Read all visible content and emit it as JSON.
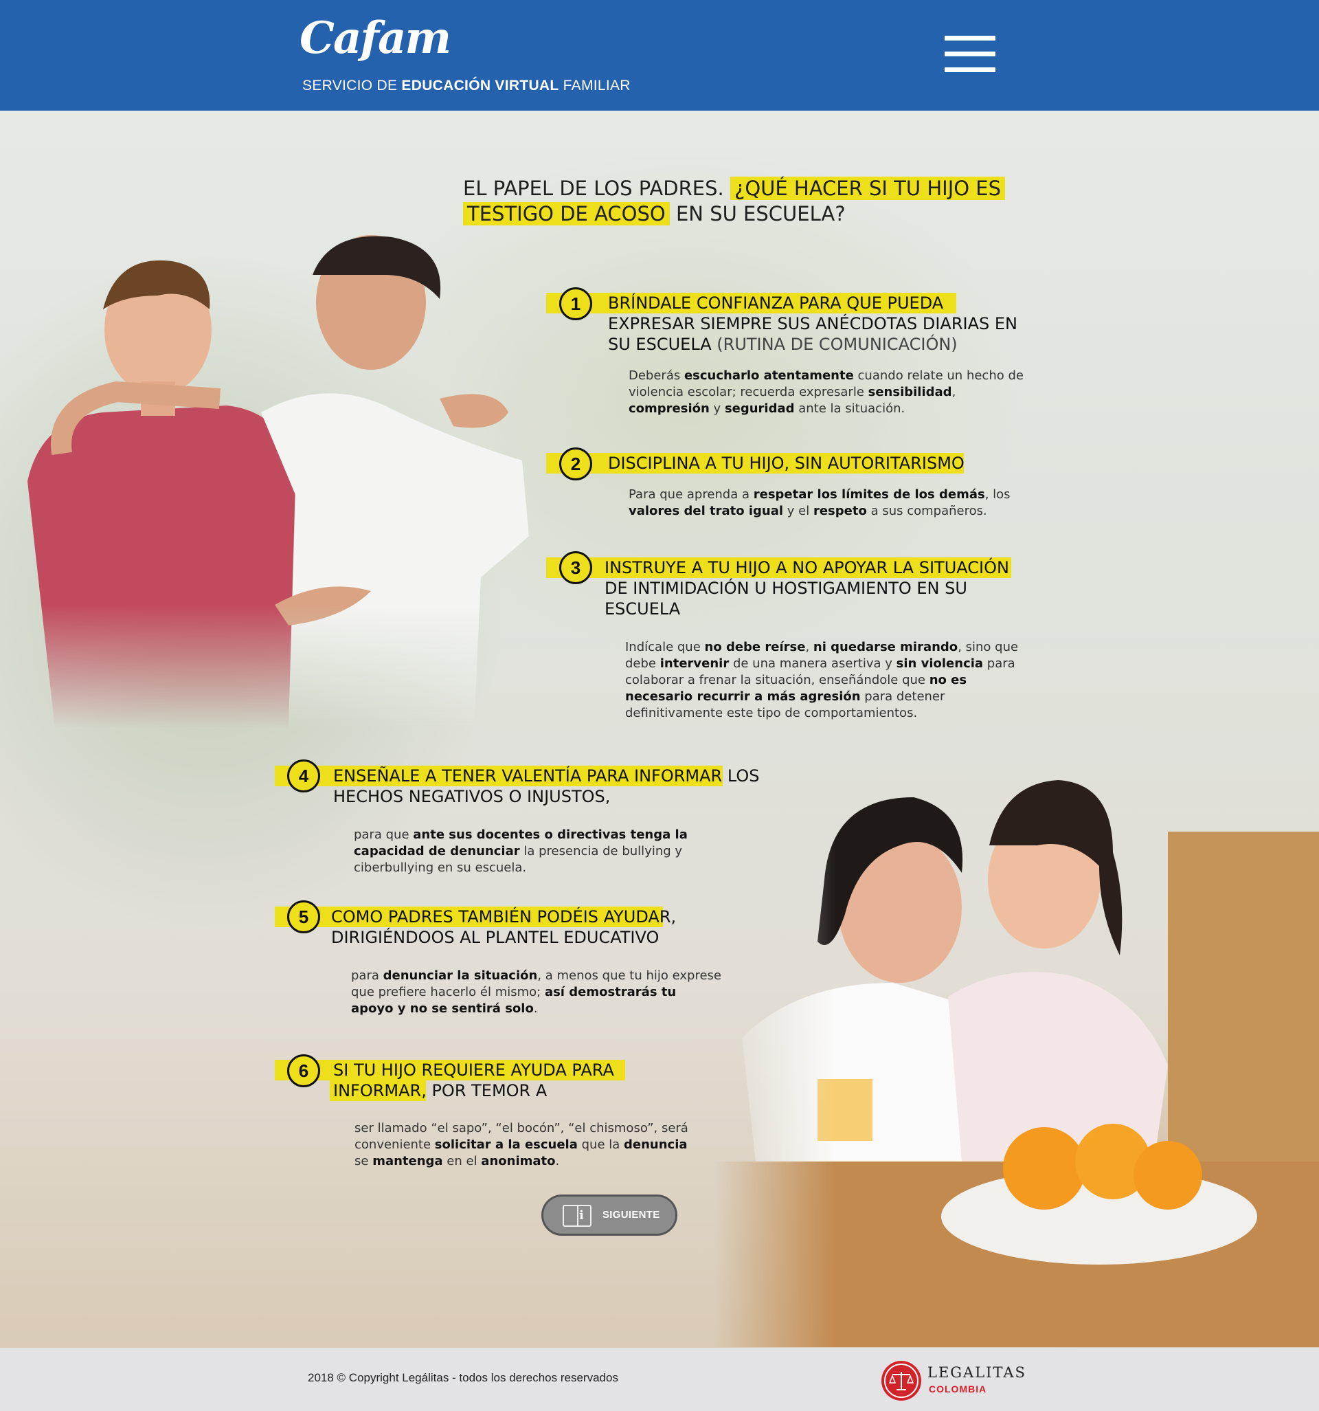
{
  "header": {
    "logo": "Cafam",
    "subtitle_pre": "SERVICIO DE ",
    "subtitle_bold": "EDUCACIÓN VIRTUAL",
    "subtitle_post": " FAMILIAR",
    "menu_icon": "hamburger-menu-icon"
  },
  "title": {
    "part1": "EL PAPEL DE LOS PADRES. ",
    "highlight1": "¿QUÉ HACER SI TU HIJO ES",
    "highlight2": "TESTIGO DE ACOSO",
    "part2": " EN SU ESCUELA?"
  },
  "items": [
    {
      "number": "1",
      "heading_hl": "BRÍNDALE CONFIANZA PARA QUE PUEDA",
      "heading_l2": "EXPRESAR SIEMPRE SUS ANÉCDOTAS DIARIAS EN",
      "heading_l3a": "SU ESCUELA",
      "heading_l3b": " (RUTINA DE COMUNICACIÓN)",
      "t1": "Deberás ",
      "b1": "escucharlo atentamente",
      "t2": " cuando relate un hecho de violencia escolar; recuerda expresarle ",
      "b2": "sensibilidad",
      "t3": ", ",
      "b3": "compresión",
      "t4": " y ",
      "b4": "seguridad",
      "t5": " ante la situación."
    },
    {
      "number": "2",
      "heading_hl": "DISCIPLINA A TU HIJO, SIN AUTORITARISMO",
      "t1": "Para que aprenda a ",
      "b1": "respetar los límites de los demás",
      "t2": ", los ",
      "b2": "valores del trato igual",
      "t3": " y el ",
      "b3": "respeto",
      "t4": " a sus compañeros."
    },
    {
      "number": "3",
      "heading_hl": "INSTRUYE A TU HIJO A NO APOYAR LA SITUACIÓN",
      "heading_l2": "DE INTIMIDACIÓN U HOSTIGAMIENTO EN SU",
      "heading_l3": "ESCUELA",
      "t1": "Indícale que ",
      "b1": "no debe reírse",
      "t2": ", ",
      "b2": "ni quedarse mirando",
      "t3": ", sino que debe ",
      "b3": "intervenir",
      "t4": " de una manera asertiva y ",
      "b4": "sin violencia",
      "t5": " para colaborar a frenar la situación, enseñándole que ",
      "b5": "no es necesario recurrir a más agresión",
      "t6": " para detener definitivamente este tipo de comportamientos."
    },
    {
      "number": "4",
      "heading_hl": "ENSEÑALE A TENER VALENTÍA PARA INFORMAR",
      "heading_rest": " LOS",
      "heading_l2": "HECHOS NEGATIVOS O INJUSTOS,",
      "t1": "para que ",
      "b1": "ante sus docentes o directivas tenga la capacidad de denunciar",
      "t2": " la presencia de bullying y ciberbullying en su escuela."
    },
    {
      "number": "5",
      "heading_hl": "COMO PADRES TAMBIÉN PODÉIS AYUDAR,",
      "heading_l2": "DIRIGIÉNDOOS AL PLANTEL EDUCATIVO",
      "t1": "para ",
      "b1": "denunciar la situación",
      "t2": ", a menos que tu hijo exprese que prefiere hacerlo él mismo; ",
      "b2": "así demostrarás tu apoyo y no se sentirá solo",
      "t3": "."
    },
    {
      "number": "6",
      "heading_hl": "SI TU HIJO REQUIERE AYUDA PARA",
      "heading_hl2": "INFORMAR",
      "heading_rest": ", POR TEMOR A",
      "t1": "ser llamado “el sapo”, “el bocón”, “el chismoso”, será conveniente ",
      "b1": "solicitar a la escuela",
      "t2": " que la ",
      "b2": "denuncia",
      "t3": " se ",
      "b3": "mantenga",
      "t4": " en el ",
      "b4": "anonimato",
      "t5": "."
    }
  ],
  "next_button": {
    "label": "SIGUIENTE",
    "icon": "book-info-icon"
  },
  "footer": {
    "copyright": "2018 © Copyright Legálitas - todos los derechos reservados",
    "brand": "LEGALITAS",
    "brand_sub": "COLOMBIA",
    "brand_icon": "scales-icon"
  },
  "colors": {
    "header": "#2462ad",
    "highlight": "#ede01b",
    "brand_red": "#d2232a"
  }
}
